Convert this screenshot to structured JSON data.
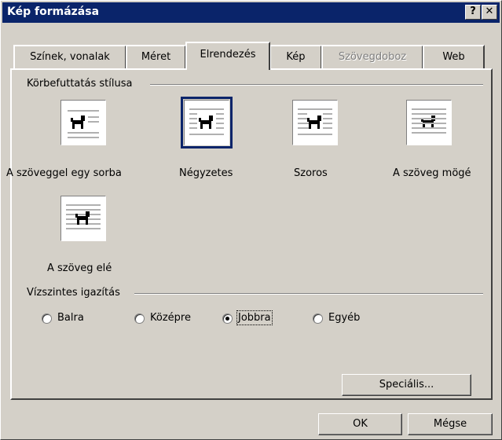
{
  "window": {
    "title": "Kép formázása",
    "help_button": "?",
    "close_button": "✕"
  },
  "tabs": [
    {
      "label": "Színek, vonalak",
      "active": false,
      "disabled": false
    },
    {
      "label": "Méret",
      "active": false,
      "disabled": false
    },
    {
      "label": "Elrendezés",
      "active": true,
      "disabled": false
    },
    {
      "label": "Kép",
      "active": false,
      "disabled": false
    },
    {
      "label": "Szövegdoboz",
      "active": false,
      "disabled": true
    },
    {
      "label": "Web",
      "active": false,
      "disabled": false
    }
  ],
  "wrap_group": {
    "label": "Körbefuttatás stílusa",
    "options": [
      {
        "label": "A szöveggel egy sorba",
        "icon": "inline-dog-icon"
      },
      {
        "label": "Négyzetes",
        "icon": "square-wrap-dog-icon",
        "selected": true
      },
      {
        "label": "Szoros",
        "icon": "tight-wrap-dog-icon"
      },
      {
        "label": "A szöveg mögé",
        "icon": "behind-text-dog-icon"
      },
      {
        "label": "A szöveg elé",
        "icon": "in-front-of-text-dog-icon"
      }
    ]
  },
  "align_group": {
    "label": "Vízszintes igazítás",
    "options": [
      {
        "label": "Balra",
        "selected": false
      },
      {
        "label": "Középre",
        "selected": false
      },
      {
        "label": "Jobbra",
        "selected": true
      },
      {
        "label": "Egyéb",
        "selected": false
      }
    ]
  },
  "buttons": {
    "advanced": "Speciális...",
    "ok": "OK",
    "cancel": "Mégse"
  },
  "colors": {
    "titlebar": "#0a246a",
    "face": "#d4d0c8"
  }
}
